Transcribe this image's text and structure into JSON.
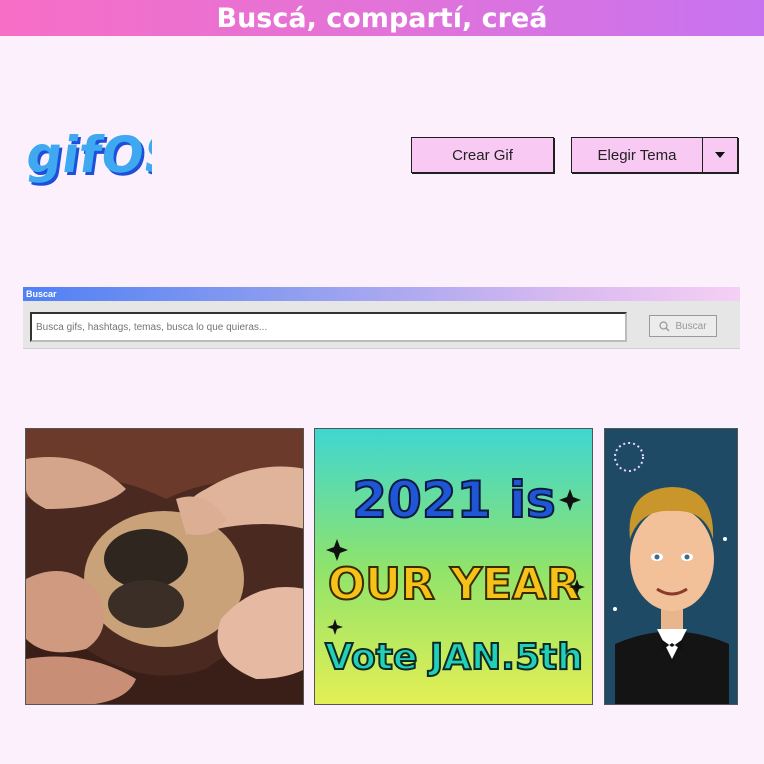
{
  "banner": {
    "text": "Buscá, compartí, creá"
  },
  "logo": {
    "text": "gifOS"
  },
  "header": {
    "create_label": "Crear Gif",
    "theme_label": "Elegir Tema"
  },
  "search": {
    "title": "Buscar",
    "placeholder": "Busca gifs, hashtags, temas, busca lo que quieras...",
    "button_label": "Buscar"
  },
  "gifs": [
    {
      "subject": "pug-face-hands"
    },
    {
      "subject": "vote-poster",
      "line1": "2021 is",
      "line2": "OUR YEAR",
      "line3": "Vote JAN.5th"
    },
    {
      "subject": "man-in-tuxedo"
    }
  ],
  "colors": {
    "background": "#fdf0fd",
    "button": "#f7c9f3",
    "accent_blue": "#4f80f4",
    "accent_pink": "#f76ec6"
  }
}
